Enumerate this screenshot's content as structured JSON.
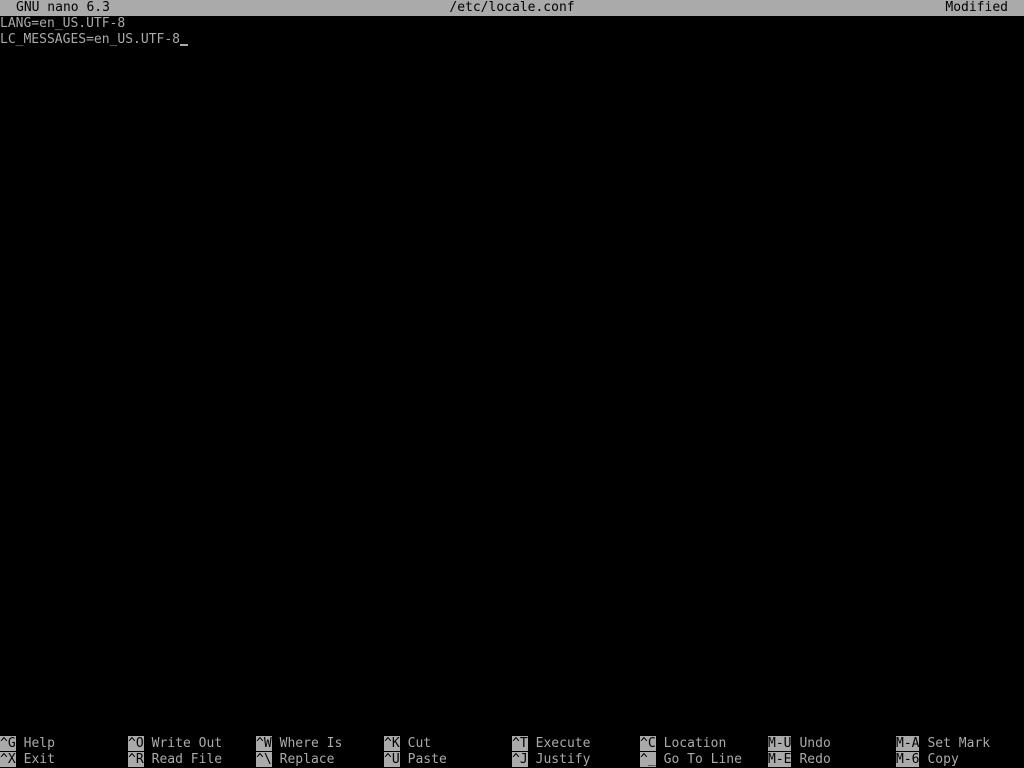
{
  "titlebar": {
    "app": "GNU nano 6.3",
    "filename": "/etc/locale.conf",
    "status": "Modified"
  },
  "editor": {
    "lines": [
      "LANG=en_US.UTF-8",
      "LC_MESSAGES=en_US.UTF-8"
    ]
  },
  "shortcuts": {
    "row1": [
      {
        "key": "^G",
        "label": "Help"
      },
      {
        "key": "^O",
        "label": "Write Out"
      },
      {
        "key": "^W",
        "label": "Where Is"
      },
      {
        "key": "^K",
        "label": "Cut"
      },
      {
        "key": "^T",
        "label": "Execute"
      },
      {
        "key": "^C",
        "label": "Location"
      },
      {
        "key": "M-U",
        "label": "Undo"
      },
      {
        "key": "M-A",
        "label": "Set Mark"
      }
    ],
    "row2": [
      {
        "key": "^X",
        "label": "Exit"
      },
      {
        "key": "^R",
        "label": "Read File"
      },
      {
        "key": "^\\",
        "label": "Replace"
      },
      {
        "key": "^U",
        "label": "Paste"
      },
      {
        "key": "^J",
        "label": "Justify"
      },
      {
        "key": "^_",
        "label": "Go To Line"
      },
      {
        "key": "M-E",
        "label": "Redo"
      },
      {
        "key": "M-6",
        "label": "Copy"
      }
    ]
  }
}
